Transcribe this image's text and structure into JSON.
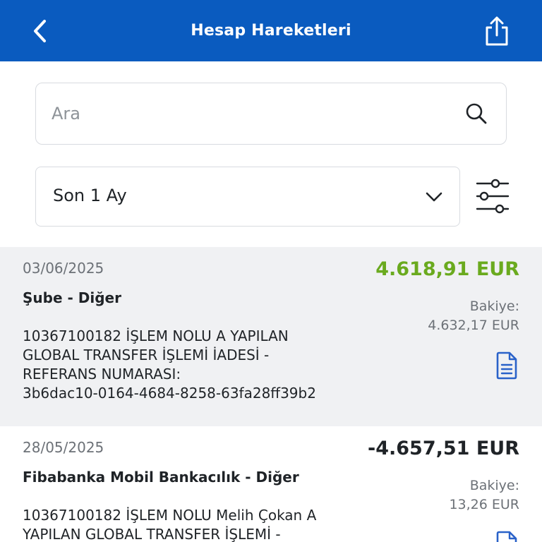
{
  "header": {
    "title": "Hesap Hareketleri",
    "back_icon": "chevron-left-icon",
    "share_icon": "share-icon"
  },
  "search": {
    "placeholder": "Ara",
    "value": "",
    "icon": "search-icon"
  },
  "filter": {
    "period_label": "Son 1 Ay",
    "dropdown_icon": "chevron-down-icon",
    "filter_icon": "sliders-icon"
  },
  "colors": {
    "header_bg": "#0a5bbf",
    "positive_amount": "#6aaa1e",
    "negative_amount": "#1f2327",
    "doc_icon": "#2a62c9"
  },
  "transactions": [
    {
      "date": "03/06/2025",
      "amount": "4.618,91 EUR",
      "amount_type": "positive",
      "channel": "Şube - Diğer",
      "balance_label": "Bakiye:",
      "balance_value": "4.632,17 EUR",
      "description": "10367100182 İŞLEM NOLU   A YAPILAN\nGLOBAL TRANSFER İŞLEMİ İADESİ -\nREFERANS NUMARASI:\n3b6dac10-0164-4684-8258-63fa28ff39b2",
      "doc_icon": "document-icon"
    },
    {
      "date": "28/05/2025",
      "amount": "-4.657,51 EUR",
      "amount_type": "negative",
      "channel": "Fibabanka Mobil Bankacılık - Diğer",
      "balance_label": "Bakiye:",
      "balance_value": "13,26 EUR",
      "description": "10367100182 İŞLEM NOLU Melih  Çokan A\nYAPILAN GLOBAL TRANSFER İŞLEMİ -",
      "doc_icon": "document-icon"
    }
  ]
}
